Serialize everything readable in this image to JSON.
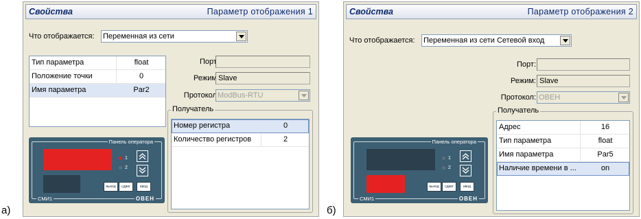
{
  "figure_labels": {
    "a": "а)",
    "b": "б)"
  },
  "panel_a": {
    "title": "Свойства",
    "subtitle": "Параметр отображения 1",
    "display_label": "Что отображается:",
    "display_value": "Переменная из сети",
    "params": [
      {
        "name": "Тип параметра",
        "value": "float"
      },
      {
        "name": "Положение точки",
        "value": "0"
      },
      {
        "name": "Имя параметра",
        "value": "Par2"
      }
    ],
    "port_label": "Порт:",
    "port_value": "",
    "mode_label": "Режим:",
    "mode_value": "Slave",
    "protocol_label": "Протокол:",
    "protocol_value": "ModBus-RTU",
    "receiver_title": "Получатель",
    "receiver_rows": [
      {
        "name": "Номер регистра",
        "value": "0"
      },
      {
        "name": "Количество регистров",
        "value": "2"
      }
    ],
    "device": {
      "title": "Панель оператора",
      "footer": "СМИ1",
      "logo": "ОВЕН",
      "led1": "1",
      "led2": "2",
      "btn_exit": "выход",
      "btn_shift": "сдвиг",
      "btn_enter": "ввод",
      "colors": {
        "display_red": "#e52222",
        "display_dark": "#2c3f4d",
        "led_on": "#e52222",
        "led_off": "#5c6f7c"
      }
    }
  },
  "panel_b": {
    "title": "Свойства",
    "subtitle": "Параметр отображения 2",
    "display_label": "Что отображается:",
    "display_value": "Переменная из сети Сетевой вход",
    "port_label": "Порт:",
    "port_value": "",
    "mode_label": "Режим:",
    "mode_value": "Slave",
    "protocol_label": "Протокол:",
    "protocol_value": "ОВЕН",
    "receiver_title": "Получатель",
    "receiver_rows": [
      {
        "name": "Адрес",
        "value": "16"
      },
      {
        "name": "Тип параметра",
        "value": "float"
      },
      {
        "name": "Имя параметра",
        "value": "Par5"
      },
      {
        "name": "Наличие времени в ...",
        "value": "on"
      }
    ],
    "device": {
      "title": "Панель оператора",
      "footer": "СМИ1",
      "logo": "ОВЕН",
      "led1": "1",
      "led2": "2",
      "btn_exit": "выход",
      "btn_shift": "сдвиг",
      "btn_enter": "ввод"
    }
  }
}
